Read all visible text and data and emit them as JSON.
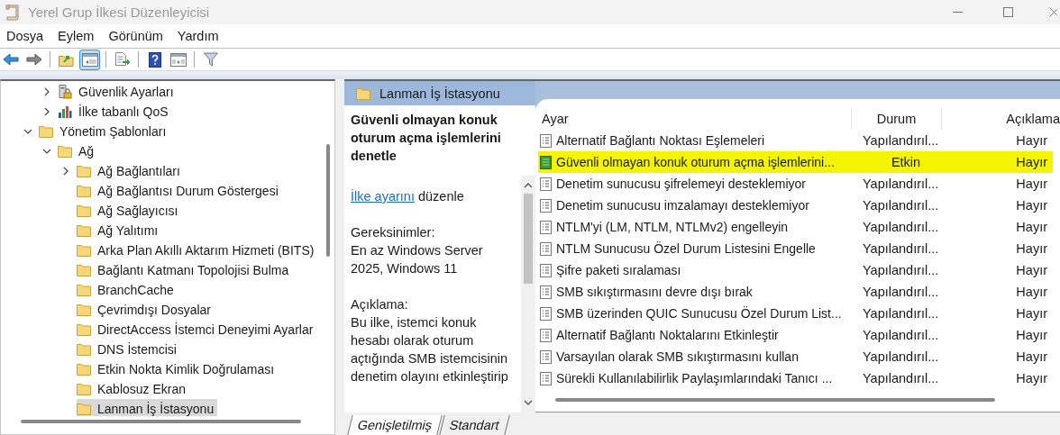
{
  "window": {
    "title": "Yerel Grup İlkesi Düzenleyicisi"
  },
  "menu": [
    "Dosya",
    "Eylem",
    "Görünüm",
    "Yardım"
  ],
  "toolbar": [
    {
      "kind": "back",
      "pressed": false,
      "separator_after": false
    },
    {
      "kind": "forward",
      "pressed": false,
      "separator_after": true
    },
    {
      "kind": "up",
      "pressed": false,
      "separator_after": false
    },
    {
      "kind": "tree",
      "pressed": true,
      "separator_after": true
    },
    {
      "kind": "export",
      "pressed": false,
      "separator_after": true
    },
    {
      "kind": "help",
      "pressed": false,
      "separator_after": false
    },
    {
      "kind": "action",
      "pressed": false,
      "separator_after": true
    },
    {
      "kind": "filter",
      "pressed": false,
      "separator_after": false
    }
  ],
  "tree": [
    {
      "children": [
        {
          "label": "Güvenlik Ayarları",
          "kind": "security",
          "expanded": false,
          "selected": false
        },
        {
          "label": "İlke tabanlı QoS",
          "kind": "qos",
          "expanded": false,
          "selected": false
        }
      ]
    },
    {
      "label": "Yönetim Şablonları",
      "kind": "folder",
      "expanded": true,
      "selected": false,
      "children": [
        {
          "label": "Ağ",
          "kind": "folder",
          "expanded": true,
          "selected": false,
          "children": [
            {
              "label": "Ağ Bağlantıları",
              "kind": "folder",
              "expanded": false,
              "selected": false
            },
            {
              "label": "Ağ Bağlantısı Durum Göstergesi",
              "kind": "folder",
              "selected": false
            },
            {
              "label": "Ağ Sağlayıcısı",
              "kind": "folder",
              "selected": false
            },
            {
              "label": "Ağ Yalıtımı",
              "kind": "folder",
              "selected": false
            },
            {
              "label": "Arka Plan Akıllı Aktarım Hizmeti (BITS)",
              "kind": "folder",
              "selected": false
            },
            {
              "label": "Bağlantı Katmanı Topolojisi Bulma",
              "kind": "folder",
              "selected": false
            },
            {
              "label": "BranchCache",
              "kind": "folder",
              "selected": false
            },
            {
              "label": "Çevrimdışı Dosyalar",
              "kind": "folder",
              "selected": false
            },
            {
              "label": "DirectAccess İstemci Deneyimi Ayarlar",
              "kind": "folder",
              "selected": false
            },
            {
              "label": "DNS İstemcisi",
              "kind": "folder",
              "selected": false
            },
            {
              "label": "Etkin Nokta Kimlik Doğrulaması",
              "kind": "folder",
              "selected": false
            },
            {
              "label": "Kablosuz Ekran",
              "kind": "folder",
              "selected": false
            },
            {
              "label": "Lanman İş İstasyonu",
              "kind": "folder",
              "selected": true
            }
          ]
        }
      ]
    }
  ],
  "details": {
    "header": "Lanman İş İstasyonu",
    "title": "Güvenli olmayan konuk oturum açma işlemlerini denetle",
    "edit_link": "İlke ayarını",
    "edit_text": "düzenle",
    "requirements_label": "Gereksinimler:",
    "requirements": "En az Windows Server 2025, Windows 11",
    "description_label": "Açıklama:",
    "description": "Bu ilke, istemci konuk hesabı olarak oturum açtığında SMB istemcisinin denetim olayını etkinleştirip"
  },
  "table": {
    "columns": [
      "Ayar",
      "Durum",
      "Açıklama"
    ],
    "rows": [
      {
        "name": "Alternatif Bağlantı Noktası Eşlemeleri",
        "state": "Yapılandırıl...",
        "comment": "Hayır",
        "kind": "policy",
        "selected": false
      },
      {
        "name": "Güvenli olmayan konuk oturum açma işlemlerini...",
        "state": "Etkin",
        "comment": "Hayır",
        "kind": "enabled",
        "selected": true
      },
      {
        "name": "Denetim sunucusu şifrelemeyi desteklemiyor",
        "state": "Yapılandırıl...",
        "comment": "Hayır",
        "kind": "policy",
        "selected": false
      },
      {
        "name": "Denetim sunucusu imzalamayı desteklemiyor",
        "state": "Yapılandırıl...",
        "comment": "Hayır",
        "kind": "policy",
        "selected": false
      },
      {
        "name": "NTLM'yi (LM, NTLM, NTLMv2) engelleyin",
        "state": "Yapılandırıl...",
        "comment": "Hayır",
        "kind": "policy",
        "selected": false
      },
      {
        "name": "NTLM Sunucusu Özel Durum Listesini Engelle",
        "state": "Yapılandırıl...",
        "comment": "Hayır",
        "kind": "policy",
        "selected": false
      },
      {
        "name": "Şifre paketi sıralaması",
        "state": "Yapılandırıl...",
        "comment": "Hayır",
        "kind": "policy",
        "selected": false
      },
      {
        "name": "SMB sıkıştırmasını devre dışı bırak",
        "state": "Yapılandırıl...",
        "comment": "Hayır",
        "kind": "policy",
        "selected": false
      },
      {
        "name": "SMB üzerinden QUIC Sunucusu Özel Durum List...",
        "state": "Yapılandırıl...",
        "comment": "Hayır",
        "kind": "policy",
        "selected": false
      },
      {
        "name": "Alternatif Bağlantı Noktalarını Etkinleştir",
        "state": "Yapılandırıl...",
        "comment": "Hayır",
        "kind": "policy",
        "selected": false
      },
      {
        "name": "Varsayılan olarak SMB sıkıştırmasını kullan",
        "state": "Yapılandırıl...",
        "comment": "Hayır",
        "kind": "policy",
        "selected": false
      },
      {
        "name": "Sürekli Kullanılabilirlik Paylaşımlarındaki Tanıcı ...",
        "state": "Yapılandırıl...",
        "comment": "Hayır",
        "kind": "policy",
        "selected": false
      }
    ]
  },
  "tabs": [
    {
      "label": "Genişletilmiş",
      "selected": true
    },
    {
      "label": "Standart",
      "selected": false
    }
  ]
}
